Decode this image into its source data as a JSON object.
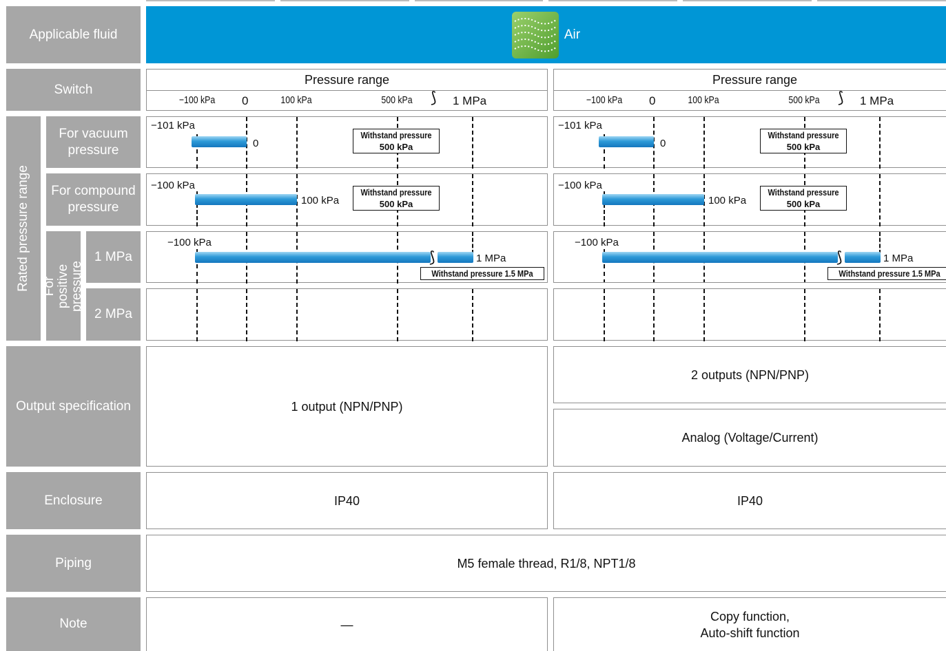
{
  "fluid": {
    "label": "Applicable fluid",
    "value": "Air",
    "icon": "air-fluid-icon"
  },
  "switch_label": "Switch",
  "rated_label": "Rated pressure range",
  "rows": {
    "vacuum": "For vacuum pressure",
    "compound": "For compound pressure",
    "positive": "For positive pressure",
    "p1": "1 MPa",
    "p2": "2 MPa"
  },
  "pressure_header": {
    "title": "Pressure range",
    "ticks": [
      "−100 kPa",
      "0",
      "100 kPa",
      "500 kPa",
      "1 MPa"
    ]
  },
  "ranges": {
    "vacuum": {
      "start": "−101 kPa",
      "end": "0"
    },
    "compound": {
      "start": "−100 kPa",
      "end": "100 kPa"
    },
    "positive": {
      "start": "−100 kPa",
      "end": "1 MPa"
    },
    "withstand_label": "Withstand pressure",
    "withstand_value": "500 kPa",
    "withstand_long": "Withstand pressure 1.5 MPa"
  },
  "output": {
    "label": "Output specification",
    "left": "1 output (NPN/PNP)",
    "right_top": "2 outputs (NPN/PNP)",
    "right_bottom": "Analog (Voltage/Current)"
  },
  "enclosure": {
    "label": "Enclosure",
    "left": "IP40",
    "right": "IP40"
  },
  "piping": {
    "label": "Piping",
    "value": "M5 female thread, R1/8, NPT1/8"
  },
  "note": {
    "label": "Note",
    "left": "—",
    "right_line1": "Copy function,",
    "right_line2": "Auto-shift function"
  },
  "colors": {
    "header_gray": "#a7a7a7",
    "fluid_blue": "#0096d6",
    "bar_blue": "#2e9ad8"
  }
}
